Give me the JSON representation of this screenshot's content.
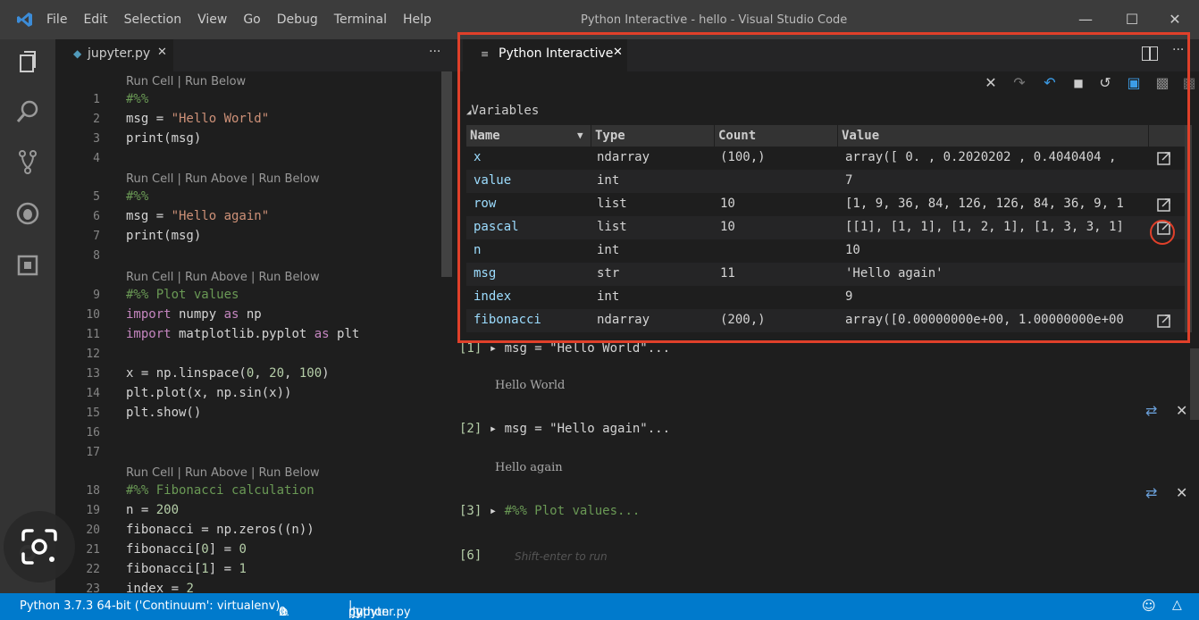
{
  "menu": [
    "File",
    "Edit",
    "Selection",
    "View",
    "Go",
    "Debug",
    "Terminal",
    "Help"
  ],
  "window_title": "Python Interactive - hello - Visual Studio Code",
  "editor": {
    "tab_label": "jupyter.py",
    "more": "···",
    "lenses": [
      "Run Cell | Run Below",
      "Run Cell | Run Above | Run Below",
      "Run Cell | Run Above | Run Below",
      "Run Cell | Run Above | Run Below"
    ],
    "line_numbers": [
      "1",
      "2",
      "3",
      "4",
      "5",
      "6",
      "7",
      "8",
      "9",
      "10",
      "11",
      "12",
      "13",
      "14",
      "15",
      "16",
      "17",
      "18",
      "19",
      "20",
      "21",
      "22",
      "23"
    ]
  },
  "interactive": {
    "tab_label": "Python Interactive",
    "more": "···",
    "variables_header": "Variables",
    "columns": [
      "Name",
      "Type",
      "Count",
      "Value"
    ],
    "rows": [
      {
        "name": "x",
        "type": "ndarray",
        "count": "(100,)",
        "value": "array([ 0. , 0.2020202 , 0.4040404 ,"
      },
      {
        "name": "value",
        "type": "int",
        "count": "",
        "value": "7"
      },
      {
        "name": "row",
        "type": "list",
        "count": "10",
        "value": "[1, 9, 36, 84, 126, 126, 84, 36, 9, 1"
      },
      {
        "name": "pascal",
        "type": "list",
        "count": "10",
        "value": "[[1], [1, 1], [1, 2, 1], [1, 3, 3, 1]"
      },
      {
        "name": "n",
        "type": "int",
        "count": "",
        "value": "10"
      },
      {
        "name": "msg",
        "type": "str",
        "count": "11",
        "value": "'Hello again'"
      },
      {
        "name": "index",
        "type": "int",
        "count": "",
        "value": "9"
      },
      {
        "name": "fibonacci",
        "type": "ndarray",
        "count": "(200,)",
        "value": "array([0.00000000e+00, 1.00000000e+00"
      }
    ],
    "history": [
      {
        "prompt": "[1]",
        "code": "msg = \"Hello World\"...",
        "output": "Hello World"
      },
      {
        "prompt": "[2]",
        "code": "msg = \"Hello again\"...",
        "output": "Hello again"
      },
      {
        "prompt": "[3]",
        "code": "#%% Plot values...",
        "output": ""
      }
    ],
    "input_prompt": "[6]",
    "input_placeholder": "Shift-enter to run"
  },
  "status": {
    "interpreter": "Python 3.7.3 64-bit ('Continuum': virtualenv)",
    "errors": "0",
    "warnings": "0",
    "language": "python",
    "file": "jupyter.py"
  },
  "colors": {
    "status_bar": "#007acc",
    "highlight": "#e0402a"
  }
}
